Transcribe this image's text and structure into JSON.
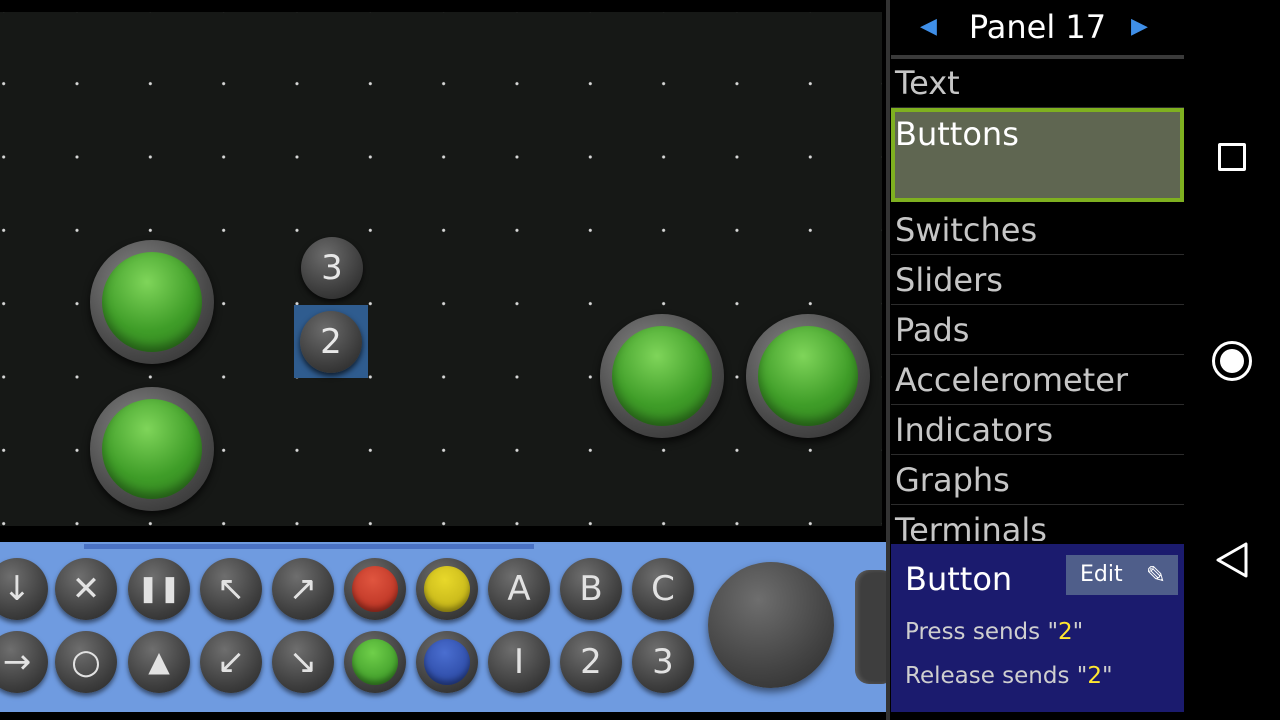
{
  "panel": {
    "title": "Panel 17",
    "prev_icon": "left-triangle",
    "next_icon": "right-triangle",
    "categories": [
      "Text",
      "Buttons",
      "Switches",
      "Sliders",
      "Pads",
      "Accelerometer",
      "Indicators",
      "Graphs",
      "Terminals"
    ],
    "selected_category": "Buttons"
  },
  "canvas": {
    "number_buttons": [
      "3",
      "2"
    ],
    "selected_button": "2",
    "green_button_count": 4
  },
  "palette": {
    "row1": [
      "down-arrow",
      "x",
      "pause",
      "up-left-arrow",
      "up-right-arrow",
      "red",
      "yellow",
      "A",
      "B",
      "C"
    ],
    "row2": [
      "right-arrow",
      "O",
      "triangle",
      "down-left-arrow",
      "down-right-arrow",
      "green",
      "blue",
      "I",
      "2",
      "3"
    ],
    "labels": {
      "A": "A",
      "B": "B",
      "C": "C",
      "I": "I",
      "two": "2",
      "three": "3"
    }
  },
  "info": {
    "title": "Button",
    "edit_label": "Edit",
    "press_prefix": "Press sends \"",
    "press_value": "2",
    "release_prefix": "Release sends \"",
    "release_value": "2",
    "suffix": "\""
  },
  "colors": {
    "accent_blue": "#3f8fe8",
    "selected_border": "#7fb020",
    "palette_bg": "#6f9be0",
    "info_bg": "#1b1b6e",
    "highlight": "#ffe830"
  }
}
